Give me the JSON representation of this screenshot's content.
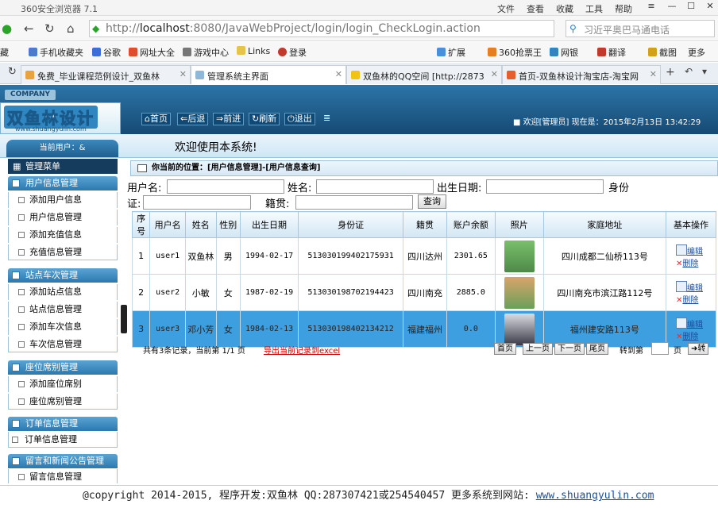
{
  "browser": {
    "title": "360安全浏览器 7.1",
    "menu": [
      "文件",
      "查看",
      "收藏",
      "工具",
      "帮助"
    ],
    "url_host": "localhost",
    "url_rest": ":8080/JavaWebProject/login/login_CheckLogin.action",
    "search_text": "习近平奥巴马通电话",
    "bookmarks": [
      "藏",
      "手机收藏夹",
      "谷歌",
      "网址大全",
      "游戏中心",
      "Links",
      "登录",
      "扩展",
      "360抢票王",
      "网银",
      "翻译",
      "截图",
      "更多"
    ],
    "tabs": [
      "免费_毕业课程范例设计_双鱼林",
      "管理系统主界面",
      "双鱼林的QQ空间 [http://2873",
      "首页-双鱼林设计淘宝店-淘宝网"
    ]
  },
  "header": {
    "company": "COMPANY",
    "logo_text": "双鱼林设计",
    "logo_url": "www.shuangyulin.com",
    "nav": [
      "首页",
      "后退",
      "前进",
      "刷新",
      "退出"
    ],
    "welcome": "欢迎[管理员]   现在是：2015年2月13日 13:42:29"
  },
  "strip_text": "欢迎使用本系统!",
  "sidebar": {
    "current_user": "当前用户：&",
    "admin_menu": "管理菜单",
    "sections": [
      {
        "title": "用户信息管理",
        "items": [
          "添加用户信息",
          "用户信息管理",
          "添加充值信息",
          "充值信息管理"
        ]
      },
      {
        "title": "站点车次管理",
        "items": [
          "添加站点信息",
          "站点信息管理",
          "添加车次信息",
          "车次信息管理"
        ]
      },
      {
        "title": "座位席别管理",
        "items": [
          "添加座位席别",
          "座位席别管理"
        ]
      },
      {
        "title": "订单信息管理",
        "items": [
          "订单信息管理"
        ]
      },
      {
        "title": "留言和新闻公告管理",
        "items": [
          "留言信息管理"
        ]
      }
    ]
  },
  "main": {
    "position": "你当前的位置：[用户信息管理]-[用户信息查询]",
    "search": {
      "username_label": "用户名:",
      "name_label": "姓名:",
      "birth_label": "出生日期:",
      "idcard_label_1": "身份",
      "idcard_label_2": "证:",
      "native_label": "籍贯:",
      "query_button": "查询"
    },
    "columns": [
      "序号",
      "用户名",
      "姓名",
      "性别",
      "出生日期",
      "身份证",
      "籍贯",
      "账户余额",
      "照片",
      "家庭地址",
      "基本操作"
    ],
    "rows": [
      {
        "no": "1",
        "user": "user1",
        "name": "双鱼林",
        "sex": "男",
        "birth": "1994-02-17",
        "id": "513030199402175931",
        "native": "四川达州",
        "balance": "2301.65",
        "address": "四川成都二仙桥113号",
        "photo_color": "#7bbf6b"
      },
      {
        "no": "2",
        "user": "user2",
        "name": "小敏",
        "sex": "女",
        "birth": "1987-02-19",
        "id": "513030198702194423",
        "native": "四川南充",
        "balance": "2885.0",
        "address": "四川南充市滨江路112号",
        "photo_color": "#d8a46a"
      },
      {
        "no": "3",
        "user": "user3",
        "name": "邓小芳",
        "sex": "女",
        "birth": "1984-02-13",
        "id": "513030198402134212",
        "native": "福建福州",
        "balance": "0.0",
        "address": "福州建安路113号",
        "photo_color": "#6d6d7d"
      }
    ],
    "edit_label": "编辑",
    "delete_label": "删除",
    "pager": {
      "info": "共有3条记录，当前第 1/1 页",
      "export": "导出当前记录到excel",
      "first": "首页",
      "prev": "上一页",
      "next": "下一页",
      "last": "尾页",
      "goto": "转到第",
      "page": "页",
      "go": "转"
    }
  },
  "footer": {
    "text": "@copyright 2014-2015, 程序开发:双鱼林  QQ:287307421或254540457  更多系统到网站: ",
    "link": "www.shuangyulin.com"
  }
}
